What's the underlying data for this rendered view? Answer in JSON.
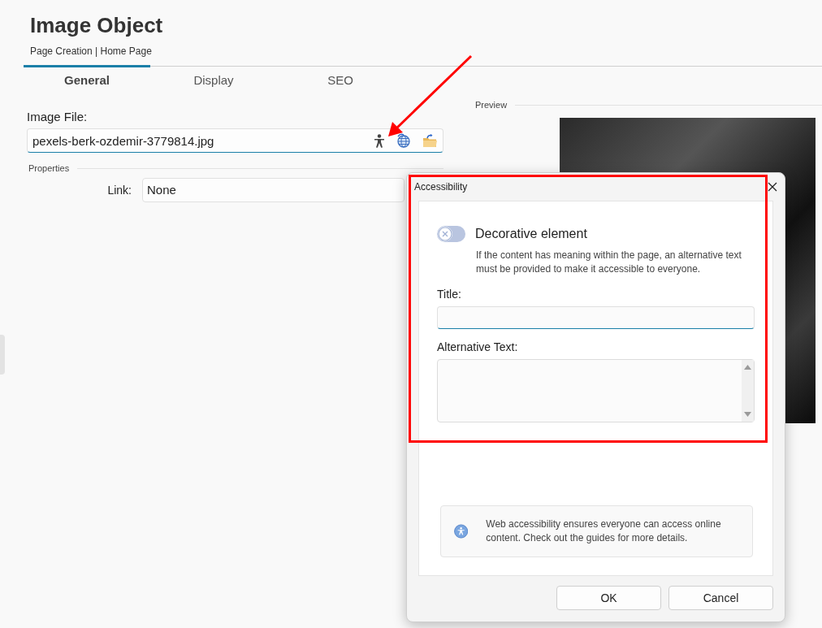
{
  "page": {
    "title": "Image Object",
    "breadcrumb": "Page Creation | Home Page"
  },
  "tabs": [
    {
      "label": "General",
      "selected": true
    },
    {
      "label": "Display",
      "selected": false
    },
    {
      "label": "SEO",
      "selected": false
    }
  ],
  "image_file": {
    "label": "Image File:",
    "value": "pexels-berk-ozdemir-3779814.jpg"
  },
  "properties": {
    "heading": "Properties",
    "link": {
      "label": "Link:",
      "value": "None"
    }
  },
  "preview": {
    "heading": "Preview"
  },
  "dialog": {
    "title": "Accessibility",
    "decorative": {
      "label": "Decorative element",
      "on": false,
      "hint": "If the content has meaning within the page, an alternative text must be provided to make it accessible to everyone."
    },
    "title_field": {
      "label": "Title:"
    },
    "alt_field": {
      "label": "Alternative Text:"
    },
    "info": "Web accessibility ensures everyone can access online content. Check out the guides for more details.",
    "buttons": [
      "OK",
      "Cancel"
    ]
  }
}
